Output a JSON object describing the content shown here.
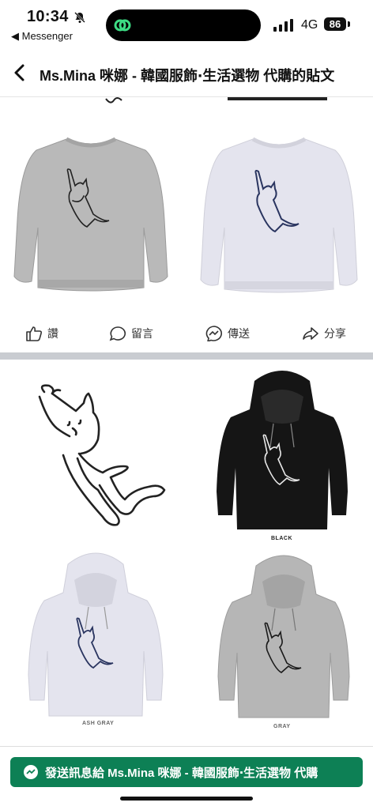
{
  "status": {
    "time": "10:34",
    "back_app": "◀ Messenger",
    "network": "4G",
    "battery": "86"
  },
  "nav": {
    "title": "Ms.Mina 咪娜 - 韓國服飾‧生活選物 代購的貼文"
  },
  "post_actions": {
    "like": "讚",
    "comment": "留言",
    "send": "傳送",
    "share": "分享"
  },
  "captions": {
    "black": "BLACK",
    "ash_gray": "ASH GRAY",
    "gray": "GRAY"
  },
  "footer": {
    "message_button": "發送訊息給 Ms.Mina 咪娜 - 韓國服飾‧生活選物 代購"
  },
  "colors": {
    "footer_button": "#0d8055",
    "divider": "#c9ccd1",
    "gray_garment": "#b9b9b9",
    "ash_garment": "#e4e4ee",
    "black_garment": "#151515",
    "cat_navy": "#2a3560"
  }
}
